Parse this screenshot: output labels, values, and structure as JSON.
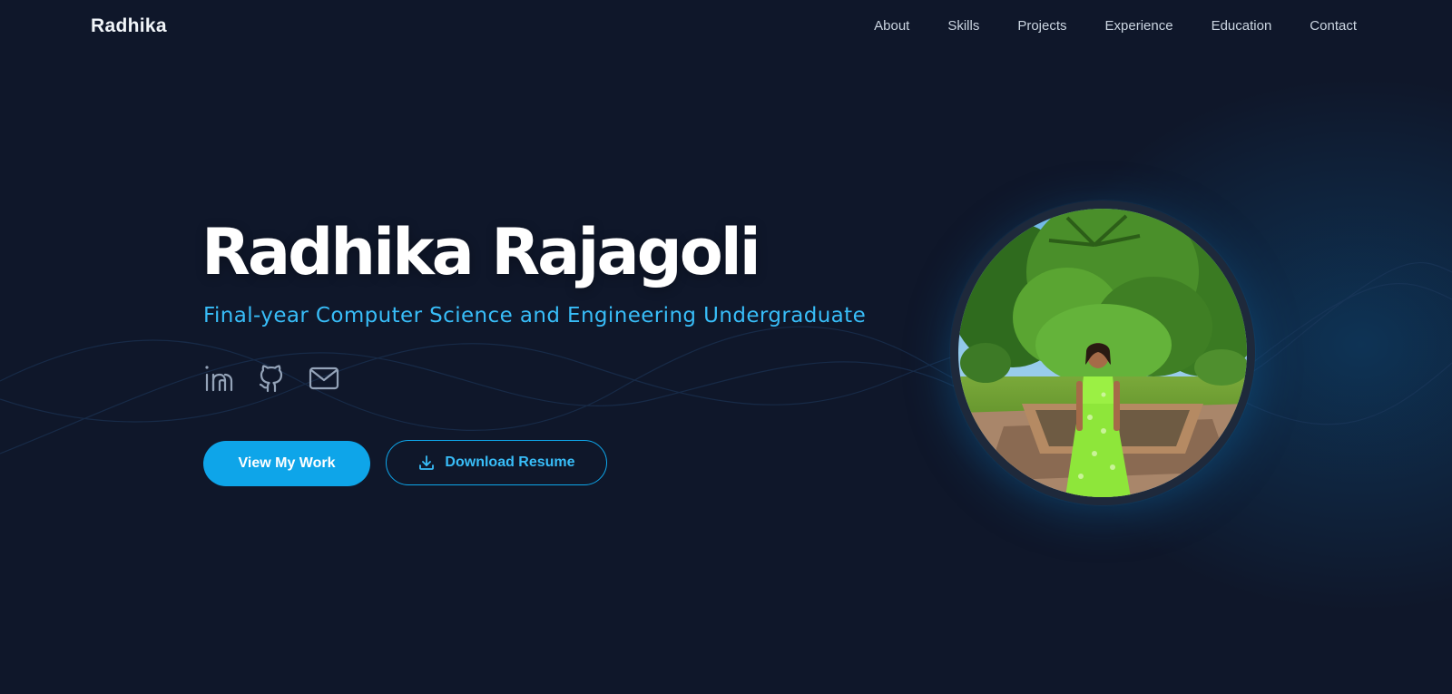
{
  "nav": {
    "brand": "Radhika",
    "links": [
      {
        "label": "About"
      },
      {
        "label": "Skills"
      },
      {
        "label": "Projects"
      },
      {
        "label": "Experience"
      },
      {
        "label": "Education"
      },
      {
        "label": "Contact"
      }
    ]
  },
  "hero": {
    "name": "Radhika Rajagoli",
    "subtitle": "Final-year Computer Science and Engineering Undergraduate",
    "socials": [
      {
        "icon": "linkedin-icon"
      },
      {
        "icon": "github-icon"
      },
      {
        "icon": "mail-icon"
      }
    ],
    "primary_button": "View My Work",
    "secondary_button": "Download Resume",
    "secondary_button_icon": "download-icon"
  },
  "colors": {
    "background": "#0f172a",
    "accent": "#0ea5e9",
    "accent_text": "#38bdf8",
    "heading": "#ffffff",
    "nav_text": "#cbd5e1"
  }
}
